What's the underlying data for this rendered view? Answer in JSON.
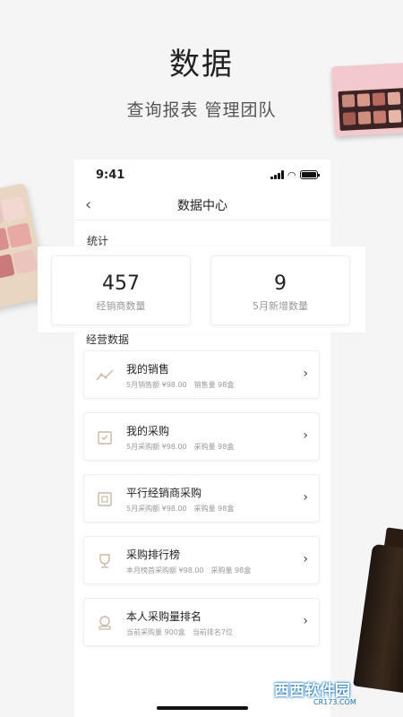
{
  "hero": {
    "title": "数据",
    "subtitle": "查询报表 管理团队"
  },
  "status_bar": {
    "time": "9:41"
  },
  "nav": {
    "title": "数据中心"
  },
  "stats": {
    "label": "统计",
    "items": [
      {
        "value": "457",
        "label": "经销商数量"
      },
      {
        "value": "9",
        "label": "5月新增数量"
      }
    ]
  },
  "ops": {
    "label": "经营数据",
    "items": [
      {
        "title": "我的销售",
        "sub1": "5月销售额 ¥98.00",
        "sub2": "销售量 98盒",
        "icon": "trend-icon"
      },
      {
        "title": "我的采购",
        "sub1": "5月采购额 ¥98.00",
        "sub2": "采购量 98盒",
        "icon": "purchase-icon"
      },
      {
        "title": "平行经销商采购",
        "sub1": "5月采购额 ¥98.00",
        "sub2": "采购量 98盒",
        "icon": "parallel-purchase-icon"
      },
      {
        "title": "采购排行榜",
        "sub1": "本月榜首采购额 ¥98.00",
        "sub2": "采购量 98盒",
        "icon": "trophy-icon"
      },
      {
        "title": "本人采购量排名",
        "sub1": "当前采购量 900盒",
        "sub2": "当前排名7位",
        "icon": "medal-icon"
      }
    ]
  },
  "watermark": {
    "text": "西西软件园",
    "domain": "CR173.COM"
  }
}
